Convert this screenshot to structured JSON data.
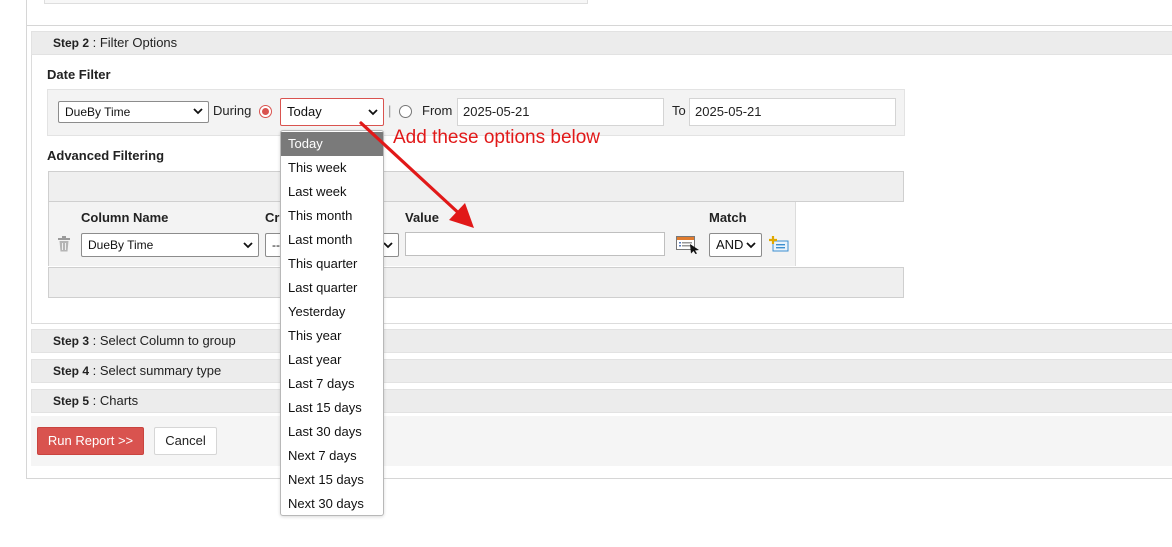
{
  "step2": {
    "title_strong": "Step 2",
    "title_rest": " : Filter Options",
    "date_filter_label": "Date Filter",
    "date_column_select": "DueBy Time",
    "during_label": "During",
    "period_select": "Today",
    "separator": "|",
    "from_label": "From",
    "from_value": "2025-05-21",
    "to_label": "To",
    "to_value": "2025-05-21",
    "advanced_label": "Advanced Filtering",
    "columns": {
      "column_name": "Column Name",
      "criteria": "Cr",
      "value": "Value",
      "match": "Match"
    },
    "row": {
      "column_select": "DueBy Time",
      "criteria_select": "--",
      "value_input": "",
      "match_select": "AND"
    }
  },
  "steps": [
    {
      "strong": "Step 3",
      "rest": " : Select Column to group"
    },
    {
      "strong": "Step 4",
      "rest": " : Select summary type"
    },
    {
      "strong": "Step 5",
      "rest": " : Charts"
    }
  ],
  "buttons": {
    "run": "Run Report >>",
    "cancel": "Cancel"
  },
  "dropdown": {
    "selected": "Today",
    "options": [
      "Today",
      "This week",
      "Last week",
      "This month",
      "Last month",
      "This quarter",
      "Last quarter",
      "Yesterday",
      "This year",
      "Last year",
      "Last 7 days",
      "Last 15 days",
      "Last 30 days",
      "Next 7 days",
      "Next 15 days",
      "Next 30 days"
    ]
  },
  "annotation": {
    "text": "Add these options below",
    "color": "#e11919"
  },
  "colors": {
    "accent_red": "#d9534f",
    "header_gray": "#ececec",
    "selected_option": "#7a7a7a"
  }
}
